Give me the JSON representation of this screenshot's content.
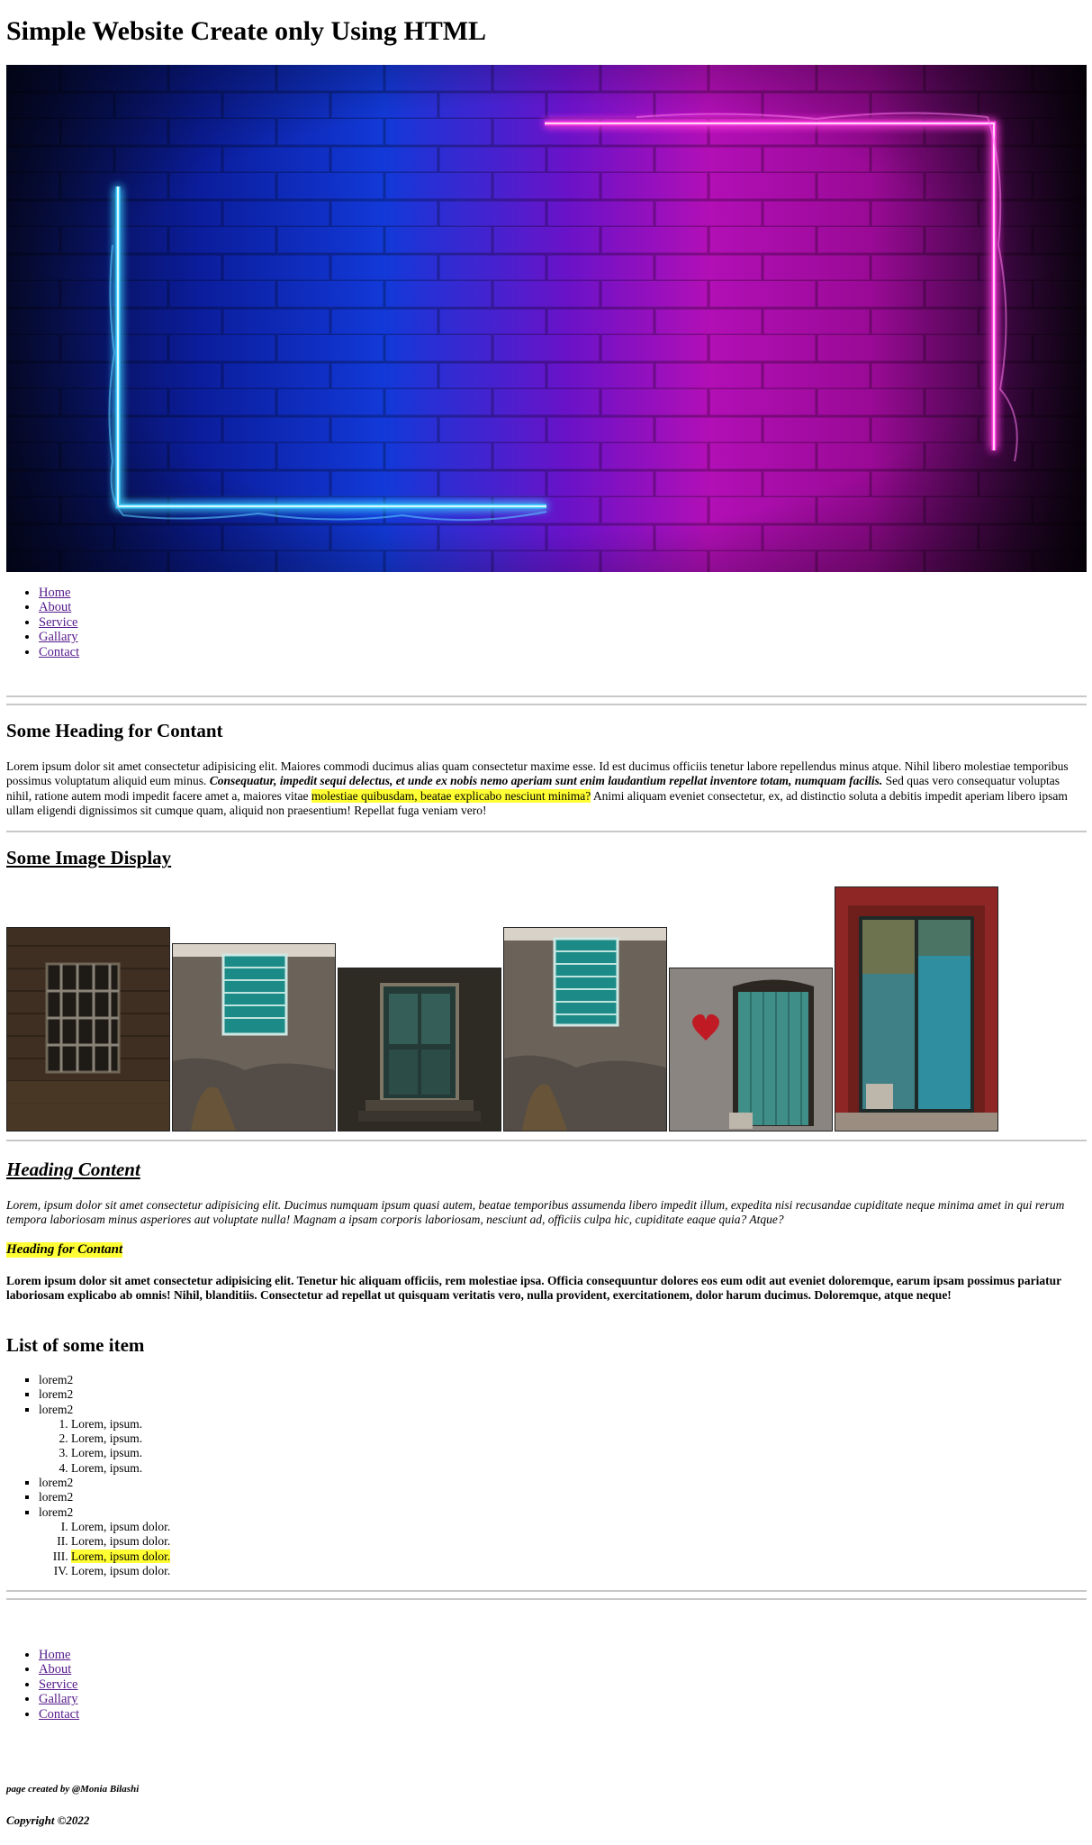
{
  "page": {
    "title": "Simple Website Create only Using HTML",
    "hero_image": "neon-frame-brick-wall"
  },
  "nav_top": [
    "Home",
    "About",
    "Service",
    "Gallary",
    "Contact"
  ],
  "section_content": {
    "heading": "Some Heading for Contant",
    "p_text1": "Lorem ipsum dolor sit amet consectetur adipisicing elit. Maiores commodi ducimus alias quam consectetur maxime esse. Id est ducimus officiis tenetur labore repellendus minus atque. Nihil libero molestiae temporibus possimus voluptatum aliquid eum minus. ",
    "p_bold_italic": "Consequatur, impedit sequi delectus, et unde ex nobis nemo aperiam sunt enim laudantium repellat inventore totam, numquam facilis.",
    "p_text2": " Sed quas vero consequatur voluptas nihil, ratione autem modi impedit facere amet a, maiores vitae ",
    "p_highlight": "molestiae quibusdam, beatae explicabo nesciunt minima?",
    "p_text3": " Animi aliquam eveniet consectetur, ex, ad distinctio soluta a debitis impedit aperiam libero ipsam ullam eligendi dignissimos sit cumque quam, aliquid non praesentium! Repellat fuga veniam vero!"
  },
  "section_images": {
    "heading": "Some Image Display",
    "images": [
      "brick-window-photo",
      "teal-window-photo",
      "green-door-photo",
      "teal-window-photo",
      "heart-door-photo",
      "red-frame-door-photo"
    ]
  },
  "section_heading_content": {
    "heading": "Heading Content",
    "italic_para": "Lorem, ipsum dolor sit amet consectetur adipisicing elit. Ducimus numquam ipsum quasi autem, beatae temporibus assumenda libero impedit illum, expedita nisi recusandae cupiditate neque minima amet in qui rerum tempora laboriosam minus asperiores aut voluptate nulla! Magnam a ipsam corporis laboriosam, nesciunt ad, officiis culpa hic, cupiditate eaque quia? Atque?",
    "highlight_heading": "Heading for Contant",
    "bold_para": "Lorem ipsum dolor sit amet consectetur adipisicing elit. Tenetur hic aliquam officiis, rem molestiae ipsa. Officia consequuntur dolores eos eum odit aut eveniet doloremque, earum ipsam possimus pariatur laboriosam explicabo ab omnis! Nihil, blanditiis. Consectetur ad repellat ut quisquam veritatis vero, nulla provident, exercitationem, dolor harum ducimus. Doloremque, atque neque!"
  },
  "list_section": {
    "heading": "List of some item",
    "items_a": [
      "lorem2",
      "lorem2",
      "lorem2"
    ],
    "ordered": [
      "Lorem, ipsum.",
      "Lorem, ipsum.",
      "Lorem, ipsum.",
      "Lorem, ipsum."
    ],
    "items_b": [
      "lorem2",
      "lorem2",
      "lorem2"
    ],
    "roman": [
      "Lorem, ipsum dolor.",
      "Lorem, ipsum dolor.",
      "Lorem, ipsum dolor.",
      "Lorem, ipsum dolor."
    ]
  },
  "nav_bottom": [
    "Home",
    "About",
    "Service",
    "Gallary",
    "Contact"
  ],
  "footer": {
    "credit": "page created by @Monia Bilashi",
    "copyright": "Copyright ©2022"
  }
}
